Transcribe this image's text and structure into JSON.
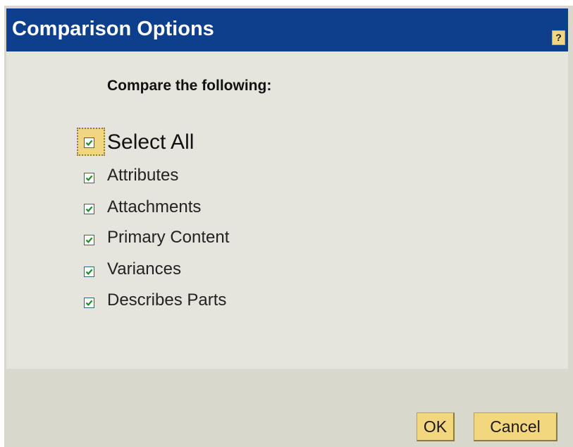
{
  "dialog": {
    "title": "Comparison Options",
    "help_label": "?"
  },
  "form": {
    "heading": "Compare the following:",
    "select_all": {
      "label": "Select All",
      "checked": true
    },
    "options": [
      {
        "label": "Attributes",
        "checked": true
      },
      {
        "label": "Attachments",
        "checked": true
      },
      {
        "label": "Primary Content",
        "checked": true
      },
      {
        "label": "Variances",
        "checked": true
      },
      {
        "label": "Describes Parts",
        "checked": true
      }
    ]
  },
  "buttons": {
    "ok": "OK",
    "cancel": "Cancel"
  },
  "colors": {
    "titlebar": "#0d3f8c",
    "button": "#f3d77e",
    "check": "#1f8a2e"
  },
  "icons": {
    "help": "help-icon",
    "checkbox": "checkmark-icon"
  }
}
